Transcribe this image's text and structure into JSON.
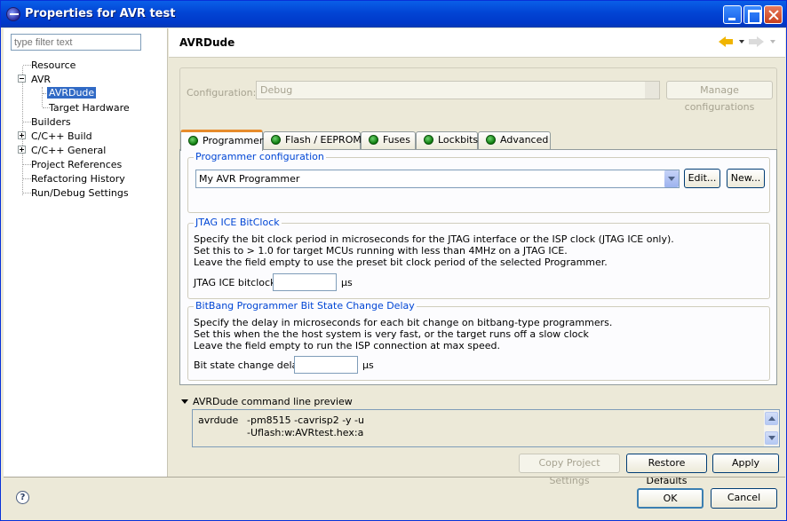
{
  "window": {
    "title": "Properties for AVR test"
  },
  "filter": {
    "placeholder": "type filter text"
  },
  "tree": {
    "items": [
      {
        "label": "Resource"
      },
      {
        "label": "AVR"
      },
      {
        "label": "AVRDude"
      },
      {
        "label": "Target Hardware"
      },
      {
        "label": "Builders"
      },
      {
        "label": "C/C++ Build"
      },
      {
        "label": "C/C++ General"
      },
      {
        "label": "Project References"
      },
      {
        "label": "Refactoring History"
      },
      {
        "label": "Run/Debug Settings"
      }
    ],
    "selected": "AVRDude"
  },
  "page": {
    "title": "AVRDude"
  },
  "configuration": {
    "label": "Configuration:",
    "value": "Debug",
    "manage_label": "Manage configurations"
  },
  "tabs": [
    {
      "label": "Programmer"
    },
    {
      "label": "Flash / EEPROM"
    },
    {
      "label": "Fuses"
    },
    {
      "label": "Lockbits"
    },
    {
      "label": "Advanced"
    }
  ],
  "active_tab": "Programmer",
  "programmer_config": {
    "title": "Programmer configuration",
    "selected": "My AVR Programmer",
    "edit_label": "Edit...",
    "new_label": "New..."
  },
  "jtag": {
    "title": "JTAG ICE BitClock",
    "lines": [
      "Specify the bit clock period in microseconds for the JTAG interface or the ISP clock (JTAG ICE only).",
      "Set this to > 1.0 for target MCUs running with less than 4MHz on a JTAG ICE.",
      "Leave the field empty to use the preset bit clock period of the selected Programmer."
    ],
    "field_label": "JTAG ICE bitclock",
    "value": "",
    "unit": "µs"
  },
  "bitbang": {
    "title": "BitBang Programmer Bit State Change Delay",
    "lines": [
      "Specify the delay in microseconds for each bit change on bitbang-type programmers.",
      "Set this when the the host system is very fast, or the target runs off a slow clock",
      "Leave the field empty to run the ISP connection at max speed."
    ],
    "field_label": "Bit state change delay",
    "value": "",
    "unit": "µs"
  },
  "preview": {
    "label": "AVRDude command line preview",
    "command": "avrdude",
    "args_line1": "-pm8515 -cavrisp2 -y -u",
    "args_line2": "-Uflash:w:AVRtest.hex:a"
  },
  "page_buttons": {
    "copy": "Copy Project Settings",
    "restore": "Restore Defaults",
    "apply": "Apply"
  },
  "dialog_buttons": {
    "ok": "OK",
    "cancel": "Cancel"
  },
  "colors": {
    "titlebar": "#0a5fe8",
    "selection": "#316ac5",
    "group_title": "#0046d5",
    "tab_active_accent": "#e68b2c",
    "status_led": "#0b7a0b"
  }
}
